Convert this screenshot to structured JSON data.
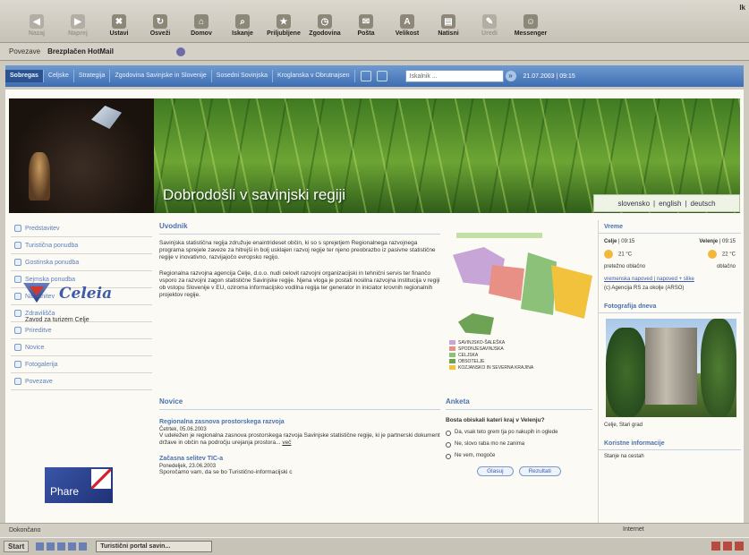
{
  "toolbar": {
    "buttons": [
      {
        "label": "Nazaj",
        "icon": "back-icon",
        "enabled": false
      },
      {
        "label": "Naprej",
        "icon": "forward-icon",
        "enabled": false
      },
      {
        "label": "Ustavi",
        "icon": "stop-icon",
        "enabled": true
      },
      {
        "label": "Osveži",
        "icon": "refresh-icon",
        "enabled": true
      },
      {
        "label": "Domov",
        "icon": "home-icon",
        "enabled": true
      },
      {
        "label": "Iskanje",
        "icon": "search-icon",
        "enabled": true
      },
      {
        "label": "Priljubljene",
        "icon": "favorites-icon",
        "enabled": true
      },
      {
        "label": "Zgodovina",
        "icon": "history-icon",
        "enabled": true
      },
      {
        "label": "Pošta",
        "icon": "mail-icon",
        "enabled": true
      },
      {
        "label": "Velikost",
        "icon": "font-size-icon",
        "enabled": true
      },
      {
        "label": "Natisni",
        "icon": "print-icon",
        "enabled": true
      },
      {
        "label": "Uredi",
        "icon": "edit-icon",
        "enabled": false
      },
      {
        "label": "Messenger",
        "icon": "messenger-icon",
        "enabled": true
      }
    ],
    "edge_label": "Ik"
  },
  "links_bar": {
    "label": "Povezave",
    "link": "Brezplačen HotMail"
  },
  "site_nav": {
    "items": [
      "Sobregas",
      "Celjske",
      "Strategija",
      "Zgodovina Savinjske in Slovenije",
      "Sosedni Sovinjska",
      "Kroglanska v Obrutnajsen"
    ],
    "active_index": 0,
    "search_placeholder": "Iskalnik ...",
    "date": "21.07.2003 | 09:15"
  },
  "banner": {
    "welcome": "Dobrodošli v savinjski regiji",
    "languages": [
      "slovensko",
      "english",
      "deutsch"
    ]
  },
  "left_menu": [
    "Predstavitev",
    "Turistična ponudba",
    "Gostinska ponudba",
    "Sejmska ponudba",
    "Nastanitev",
    "Zdravilišča",
    "Prireditve",
    "Novice",
    "Fotogalerija",
    "Povezave"
  ],
  "celeia": {
    "name": "Celeia",
    "subtitle": "Zavod za turizem Celje"
  },
  "phare": {
    "label": "Phare"
  },
  "uvodnik": {
    "heading": "Uvodnik",
    "p1": "Savinjska statistična regija združuje enaintrideset občin, ki so s sprejetjem Regionalnega razvojnega programa sprejele zaveze za hitrejši in bolj usklajen razvoj regije ter njeno preobrazbo iz pasivne statistične regije v inovativno, razvijajočo evropsko regijo.",
    "p2": "Regionalna razvojna agencija Celje, d.o.o. nudi celovit razvojni organizacijski in tehnični servis ter finančo vsporo za razvojni zagon statistične Savinjske regije. Njena vloga je postati nosilna razvojna institucija v regiji ob vstopu Slovenije v EU, oziroma informacijsko vodilna regija ter generator in iniciator krovnih regionalnih projektov regije."
  },
  "map": {
    "legend": [
      "SAVINJSKO-ŠALEŠKA",
      "SPODNJESAVINJSKA",
      "CELJSKA",
      "OBSOTELJE",
      "KOZJANSKO IN SEVERNA KRAJINA"
    ]
  },
  "novice": {
    "heading": "Novice",
    "items": [
      {
        "title": "Regionalna zasnova prostorskega razvoja",
        "date": "Četrtek, 05.06.2003",
        "text": "V udeležen je regionalna zasnova prostorskega razvoja Savinjske statistične regije, ki je partnerski dokument države in občin na področju urejanja prostora...",
        "more": "več"
      },
      {
        "title": "Začasna selitev TIC-a",
        "date": "Ponedeljek, 23.06.2003",
        "text": "Sporočamo vam, da se bo Turistično-informacijski c"
      }
    ]
  },
  "anketa": {
    "heading": "Anketa",
    "question": "Bosta obiskali kateri kraj v Velenju?",
    "options": [
      "Da, vsak teto grem tja po nakupih in oglede",
      "Ne, slovo raba mo ne zanima",
      "Ne vem, mogoče"
    ],
    "vote_label": "Glasuj",
    "results_label": "Rezultati"
  },
  "vreme": {
    "heading": "Vreme",
    "cities": [
      {
        "name": "Celje",
        "time": "09:15",
        "temp": "21 °C",
        "desc": "pretežno oblačno"
      },
      {
        "name": "Velenje",
        "time": "09:15",
        "temp": "22 °C",
        "desc": "oblačno"
      }
    ],
    "links": "vremenska napoved | napoved + slike",
    "credit": "(c) Agencija RS za okolje (ARSO)"
  },
  "photo": {
    "heading": "Fotografija dneva",
    "caption": "Celje, Stari grad"
  },
  "useful": {
    "heading": "Koristne informacije",
    "text": "Stanje na cestah"
  },
  "status_bar": {
    "text": "Dokončano",
    "zone": "Internet"
  },
  "taskbar": {
    "start": "Start",
    "task": "Turistični portal savin..."
  }
}
